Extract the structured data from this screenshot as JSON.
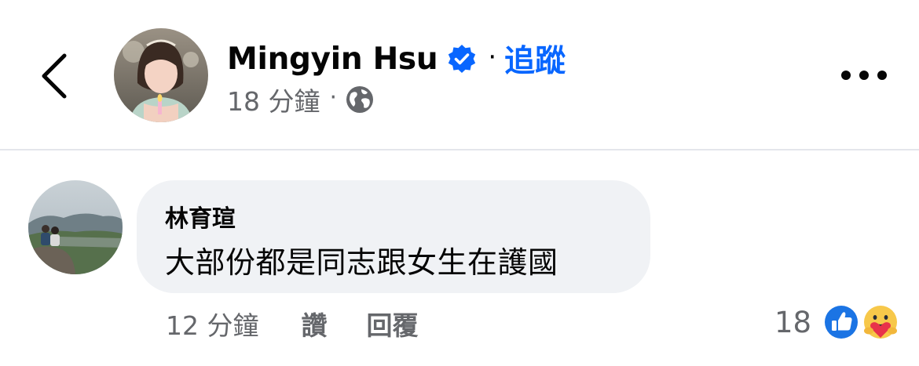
{
  "header": {
    "back_icon": "chevron-left-icon",
    "author_name": "Mingyin Hsu",
    "verified_icon": "verified-badge-icon",
    "separator": "·",
    "follow_label": "追蹤",
    "post_time": "18 分鐘",
    "meta_separator": "·",
    "privacy_icon": "globe-icon",
    "more_icon": "more-horizontal-icon"
  },
  "comment": {
    "author": "林育瑄",
    "text": "大部份都是同志跟女生在護國",
    "time": "12 分鐘",
    "like_label": "讚",
    "reply_label": "回覆",
    "reaction_count": "18",
    "reactions": [
      "like-reaction-icon",
      "care-reaction-icon"
    ]
  },
  "colors": {
    "accent": "#0866ff",
    "secondary_text": "#65676b",
    "bubble": "#f0f2f5",
    "divider": "#e4e6eb"
  }
}
